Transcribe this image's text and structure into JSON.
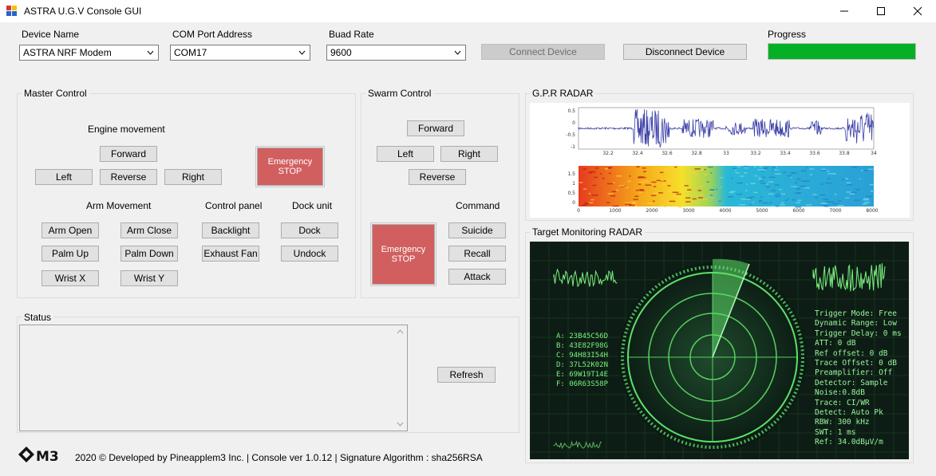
{
  "window": {
    "title": "ASTRA U.G.V Console GUI"
  },
  "connection": {
    "device_name_label": "Device Name",
    "device_name_value": "ASTRA NRF Modem",
    "com_port_label": "COM Port Address",
    "com_port_value": "COM17",
    "baud_label": "Buad Rate",
    "baud_value": "9600",
    "connect_label": "Connect Device",
    "disconnect_label": "Disconnect Device",
    "progress_label": "Progress",
    "progress_fraction": 1.0,
    "progress_color": "#06b025"
  },
  "master": {
    "title": "Master Control",
    "engine_heading": "Engine movement",
    "forward": "Forward",
    "left": "Left",
    "reverse": "Reverse",
    "right": "Right",
    "emergency": "Emergency\nSTOP",
    "arm_heading": "Arm Movement",
    "arm_open": "Arm Open",
    "arm_close": "Arm Close",
    "palm_up": "Palm Up",
    "palm_down": "Palm Down",
    "wrist_x": "Wrist X",
    "wrist_y": "Wrist Y",
    "control_heading": "Control panel",
    "backlight": "Backlight",
    "exhaust_fan": "Exhaust Fan",
    "dock_heading": "Dock unit",
    "dock": "Dock",
    "undock": "Undock"
  },
  "swarm": {
    "title": "Swarm Control",
    "forward": "Forward",
    "left": "Left",
    "right": "Right",
    "reverse": "Reverse",
    "emergency": "Emergency\nSTOP",
    "command_heading": "Command",
    "suicide": "Suicide",
    "recall": "Recall",
    "attack": "Attack"
  },
  "status": {
    "title": "Status",
    "refresh": "Refresh"
  },
  "gpr": {
    "title": "G.P.R RADAR",
    "wave_yticks": [
      "0.5",
      "0",
      "-0.5",
      "-1"
    ],
    "wave_xticks": [
      "32.2",
      "32.4",
      "32.6",
      "32.8",
      "33",
      "33.2",
      "33.4",
      "33.6",
      "33.8",
      "34"
    ],
    "spec_yticks": [
      "1.5",
      "1",
      "0.5",
      "0"
    ],
    "spec_xticks": [
      "0",
      "1000",
      "2000",
      "3000",
      "4000",
      "5000",
      "6000",
      "7000",
      "8000"
    ]
  },
  "target": {
    "title": "Target Monitoring RADAR",
    "coords": [
      "A: 23B45C56D",
      "B: 43E82F98G",
      "C: 94H83I54H",
      "D: 37L52K02N",
      "E: 69W19T14E",
      "F: 06R63S58P"
    ],
    "readout": [
      "Trigger Mode: Free",
      "Dynamic Range: Low",
      "Trigger Delay: 0 ms",
      "ATT: 0 dB",
      "Ref offset: 0 dB",
      "Trace Offset: 0 dB",
      "Preamplifier: Off",
      "Detector: Sample",
      "Noise:0.8dB",
      "Trace: CI/WR",
      "Detect: Auto Pk",
      "RBW: 300 kHz",
      "SWT: 1 ms",
      "Ref: 34.0dBµV/m"
    ]
  },
  "footer": {
    "logo_text": "M3",
    "credit": "2020 © Developed by Pineapplem3 Inc. | Console ver 1.0.12 |  Signature Algorithm : sha256RSA"
  }
}
